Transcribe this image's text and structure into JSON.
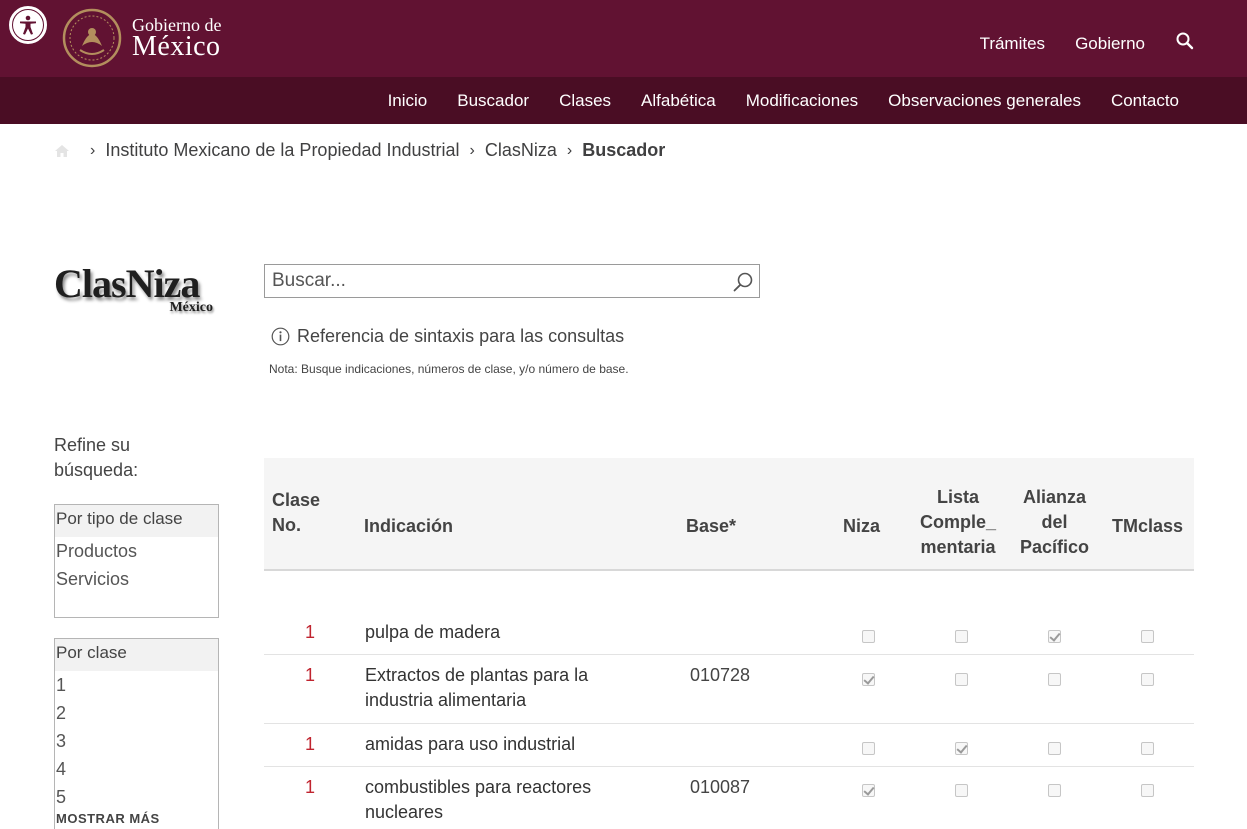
{
  "header": {
    "logo_line1": "Gobierno de",
    "logo_line2": "México",
    "links": [
      "Trámites",
      "Gobierno"
    ]
  },
  "nav": [
    "Inicio",
    "Buscador",
    "Clases",
    "Alfabética",
    "Modificaciones",
    "Observaciones generales",
    "Contacto"
  ],
  "breadcrumb": {
    "items": [
      "Instituto Mexicano de la Propiedad Industrial",
      "ClasNiza"
    ],
    "current": "Buscador"
  },
  "brand": {
    "title": "ClasNiza",
    "subtitle": "México"
  },
  "search": {
    "placeholder": "Buscar...",
    "syntax_link": "Referencia de sintaxis para las consultas",
    "note": "Nota: Busque indicaciones, números de clase,  y/o número de base."
  },
  "sidebar": {
    "refine_label": "Refine su búsqueda:",
    "facet_type": {
      "title": "Por tipo de clase",
      "items": [
        "Productos",
        "Servicios"
      ]
    },
    "facet_class": {
      "title": "Por clase",
      "items": [
        "1",
        "2",
        "3",
        "4",
        "5"
      ],
      "more": "MOSTRAR MÁS"
    }
  },
  "table": {
    "headers": {
      "clase_l1": "Clase",
      "clase_l2": "No.",
      "indicacion": "Indicación",
      "base": "Base*",
      "niza": "Niza",
      "lista_l1": "Lista",
      "lista_l2": "Comple_",
      "lista_l3": "mentaria",
      "alianza_l1": "Alianza",
      "alianza_l2": "del",
      "alianza_l3": "Pacífico",
      "tmclass": "TMclass"
    },
    "rows": [
      {
        "clase": "1",
        "indicacion": "pulpa de madera",
        "base": "",
        "niza": false,
        "lista": false,
        "alianza": true,
        "tmclass": false
      },
      {
        "clase": "1",
        "indicacion": "Extractos de plantas para la industria alimentaria",
        "base": "010728",
        "niza": true,
        "lista": false,
        "alianza": false,
        "tmclass": false
      },
      {
        "clase": "1",
        "indicacion": "amidas para uso industrial",
        "base": "",
        "niza": false,
        "lista": true,
        "alianza": false,
        "tmclass": false
      },
      {
        "clase": "1",
        "indicacion": "combustibles para reactores nucleares",
        "base": "010087",
        "niza": true,
        "lista": false,
        "alianza": false,
        "tmclass": false
      }
    ]
  }
}
